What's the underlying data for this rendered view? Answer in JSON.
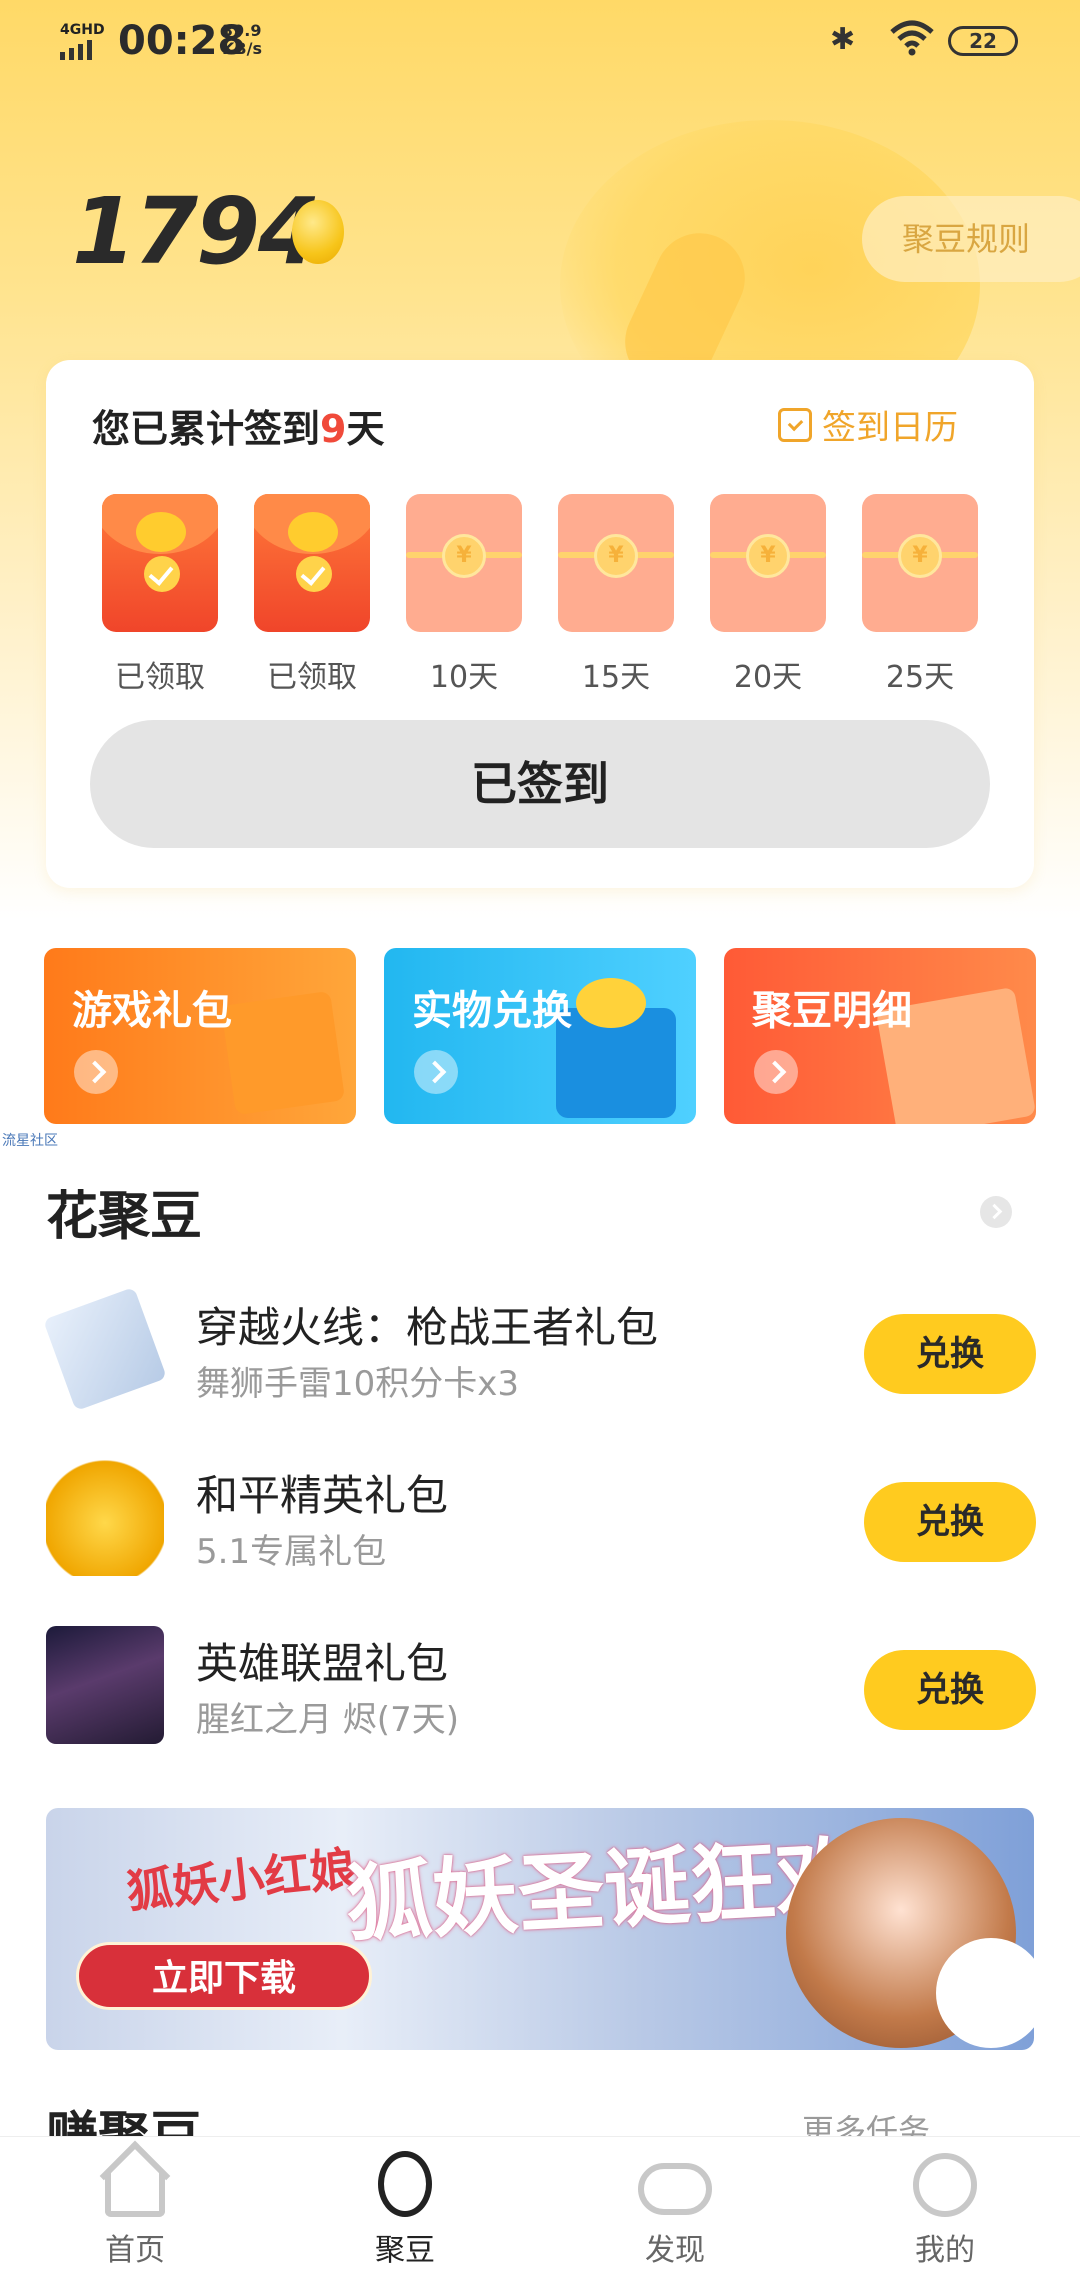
{
  "status_bar": {
    "network": "4GHD",
    "time": "00:28",
    "speed_value": "39.9",
    "speed_unit": "KB/s",
    "battery": "22"
  },
  "header": {
    "balance": "1794",
    "rules_button": "聚豆规则"
  },
  "sign_card": {
    "title_prefix": "您已累计签到",
    "days": "9",
    "title_suffix": "天",
    "calendar_link": "签到日历",
    "rewards": [
      {
        "label": "已领取",
        "state": "claimed"
      },
      {
        "label": "已领取",
        "state": "claimed"
      },
      {
        "label": "10天",
        "state": "locked"
      },
      {
        "label": "15天",
        "state": "locked"
      },
      {
        "label": "20天",
        "state": "locked"
      },
      {
        "label": "25天",
        "state": "locked"
      }
    ],
    "yuan_symbol": "¥",
    "signed_button": "已签到"
  },
  "quick_links": [
    {
      "label": "游戏礼包",
      "color": "#ff7a1a"
    },
    {
      "label": "实物兑换",
      "color": "#22b7f0"
    },
    {
      "label": "聚豆明细",
      "color": "#ff5a36"
    }
  ],
  "watermark": "流星社区",
  "spend_section": {
    "title": "花聚豆",
    "items": [
      {
        "name": "穿越火线：枪战王者礼包",
        "desc": "舞狮手雷10积分卡x3",
        "button": "兑换"
      },
      {
        "name": "和平精英礼包",
        "desc": "5.1专属礼包",
        "button": "兑换"
      },
      {
        "name": "英雄联盟礼包",
        "desc": "腥红之月 烬(7天)",
        "button": "兑换"
      }
    ]
  },
  "promo_banner": {
    "logo_text": "狐妖小红娘",
    "download_button": "立即下载",
    "headline": "狐妖圣诞狂欢日"
  },
  "earn_section": {
    "title": "赚聚豆",
    "more": "更多任务"
  },
  "bottom_nav": [
    {
      "label": "首页",
      "icon": "home-icon",
      "active": false
    },
    {
      "label": "聚豆",
      "icon": "bean-icon",
      "active": true
    },
    {
      "label": "发现",
      "icon": "gamepad-icon",
      "active": false
    },
    {
      "label": "我的",
      "icon": "profile-icon",
      "active": false
    }
  ],
  "colors": {
    "accent": "#ffcb1f",
    "days_highlight": "#f04a3a",
    "calendar_link": "#f0a52a"
  }
}
